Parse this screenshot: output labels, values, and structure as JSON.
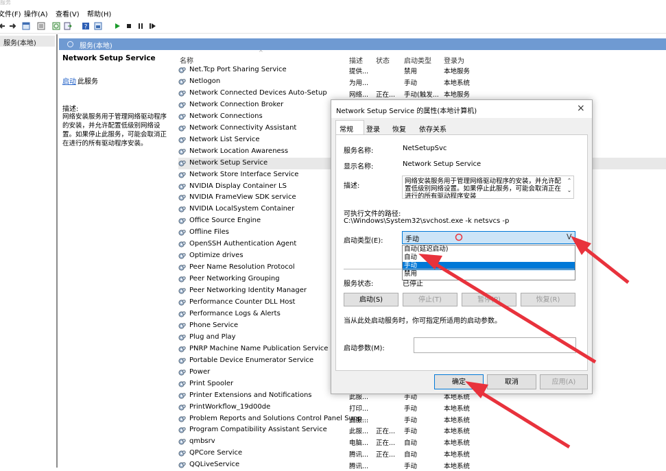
{
  "window": {
    "title": "服务"
  },
  "menu": [
    "文件(F)",
    "操作(A)",
    "查看(V)",
    "帮助(H)"
  ],
  "tree": {
    "item": "服务(本地)"
  },
  "header": {
    "title": "服务(本地)"
  },
  "left_pane": {
    "title": "Network Setup Service",
    "start_link": "启动",
    "start_suffix": "此服务",
    "desc_label": "描述:",
    "desc_text": "网络安装服务用于管理网络驱动程序的安装，并允许配置低级别网络设置。如果停止此服务，可能会取消正在进行的所有驱动程序安装。"
  },
  "columns": {
    "name": "名称",
    "desc": "描述",
    "status": "状态",
    "startup": "启动类型",
    "logon": "登录为"
  },
  "services": [
    {
      "name": "Net.Tcp Port Sharing Service",
      "desc": "提供...",
      "status": "",
      "startup": "禁用",
      "logon": "本地服务"
    },
    {
      "name": "Netlogon",
      "desc": "为用...",
      "status": "",
      "startup": "手动",
      "logon": "本地系统"
    },
    {
      "name": "Network Connected Devices Auto-Setup",
      "desc": "网络...",
      "status": "正在...",
      "startup": "手动(触发...",
      "logon": "本地服务"
    },
    {
      "name": "Network Connection Broker",
      "desc": "",
      "status": "",
      "startup": "",
      "logon": ""
    },
    {
      "name": "Network Connections",
      "desc": "",
      "status": "",
      "startup": "",
      "logon": ""
    },
    {
      "name": "Network Connectivity Assistant",
      "desc": "",
      "status": "",
      "startup": "",
      "logon": ""
    },
    {
      "name": "Network List Service",
      "desc": "",
      "status": "",
      "startup": "",
      "logon": ""
    },
    {
      "name": "Network Location Awareness",
      "desc": "",
      "status": "",
      "startup": "",
      "logon": ""
    },
    {
      "name": "Network Setup Service",
      "desc": "",
      "status": "",
      "startup": "",
      "logon": ""
    },
    {
      "name": "Network Store Interface Service",
      "desc": "",
      "status": "",
      "startup": "",
      "logon": ""
    },
    {
      "name": "NVIDIA Display Container LS",
      "desc": "",
      "status": "",
      "startup": "",
      "logon": ""
    },
    {
      "name": "NVIDIA FrameView SDK service",
      "desc": "",
      "status": "",
      "startup": "",
      "logon": ""
    },
    {
      "name": "NVIDIA LocalSystem Container",
      "desc": "",
      "status": "",
      "startup": "",
      "logon": ""
    },
    {
      "name": "Office  Source Engine",
      "desc": "",
      "status": "",
      "startup": "",
      "logon": ""
    },
    {
      "name": "Offline Files",
      "desc": "",
      "status": "",
      "startup": "",
      "logon": ""
    },
    {
      "name": "OpenSSH Authentication Agent",
      "desc": "",
      "status": "",
      "startup": "",
      "logon": ""
    },
    {
      "name": "Optimize drives",
      "desc": "",
      "status": "",
      "startup": "",
      "logon": ""
    },
    {
      "name": "Peer Name Resolution Protocol",
      "desc": "",
      "status": "",
      "startup": "",
      "logon": ""
    },
    {
      "name": "Peer Networking Grouping",
      "desc": "",
      "status": "",
      "startup": "",
      "logon": ""
    },
    {
      "name": "Peer Networking Identity Manager",
      "desc": "",
      "status": "",
      "startup": "",
      "logon": ""
    },
    {
      "name": "Performance Counter DLL Host",
      "desc": "",
      "status": "",
      "startup": "",
      "logon": ""
    },
    {
      "name": "Performance Logs & Alerts",
      "desc": "",
      "status": "",
      "startup": "",
      "logon": ""
    },
    {
      "name": "Phone Service",
      "desc": "",
      "status": "",
      "startup": "",
      "logon": ""
    },
    {
      "name": "Plug and Play",
      "desc": "",
      "status": "",
      "startup": "",
      "logon": ""
    },
    {
      "name": "PNRP Machine Name Publication Service",
      "desc": "",
      "status": "",
      "startup": "",
      "logon": ""
    },
    {
      "name": "Portable Device Enumerator Service",
      "desc": "",
      "status": "",
      "startup": "",
      "logon": ""
    },
    {
      "name": "Power",
      "desc": "",
      "status": "",
      "startup": "",
      "logon": ""
    },
    {
      "name": "Print Spooler",
      "desc": "",
      "status": "",
      "startup": "",
      "logon": ""
    },
    {
      "name": "Printer Extensions and Notifications",
      "desc": "此服...",
      "status": "",
      "startup": "手动",
      "logon": "本地系统"
    },
    {
      "name": "PrintWorkflow_19d00de",
      "desc": "打印...",
      "status": "",
      "startup": "手动",
      "logon": "本地系统"
    },
    {
      "name": "Problem Reports and Solutions Control Panel Supp...",
      "desc": "此服...",
      "status": "",
      "startup": "手动",
      "logon": "本地系统"
    },
    {
      "name": "Program Compatibility Assistant Service",
      "desc": "此服...",
      "status": "正在...",
      "startup": "手动",
      "logon": "本地系统"
    },
    {
      "name": "qmbsrv",
      "desc": "电脑...",
      "status": "正在...",
      "startup": "自动",
      "logon": "本地系统"
    },
    {
      "name": "QPCore Service",
      "desc": "腾讯...",
      "status": "正在...",
      "startup": "自动",
      "logon": "本地系统"
    },
    {
      "name": "QQLiveService",
      "desc": "腾讯...",
      "status": "",
      "startup": "手动",
      "logon": "本地系统"
    }
  ],
  "dialog": {
    "title": "Network Setup Service 的属性(本地计算机)",
    "close": "×",
    "tabs": [
      "常规",
      "登录",
      "恢复",
      "依存关系"
    ],
    "service_name_label": "服务名称:",
    "service_name": "NetSetupSvc",
    "display_name_label": "显示名称:",
    "display_name": "Network Setup Service",
    "desc_label": "描述:",
    "desc": "网络安装服务用于管理网络驱动程序的安装，并允许配置低级别网络设置。如果停止此服务，可能会取消正在进行的所有驱动程序安装",
    "path_label": "可执行文件的路径:",
    "path": "C:\\Windows\\System32\\svchost.exe -k netsvcs -p",
    "startup_label": "启动类型(E):",
    "startup_value": "手动",
    "startup_options": [
      "自动(延迟启动)",
      "自动",
      "手动",
      "禁用"
    ],
    "startup_highlighted": "手动",
    "status_label": "服务状态:",
    "status_value": "已停止",
    "btn_start": "启动(S)",
    "btn_stop": "停止(T)",
    "btn_pause": "暂停(P)",
    "btn_resume": "恢复(R)",
    "hint": "当从此处启动服务时，你可指定所适用的启动参数。",
    "params_label": "启动参数(M):",
    "params_value": "",
    "btn_ok": "确定",
    "btn_cancel": "取消",
    "btn_apply": "应用(A)"
  },
  "colors": {
    "header": "#6f9ad2",
    "selection": "#0078d7",
    "arrow": "#e8323c",
    "link": "#2060c8"
  }
}
